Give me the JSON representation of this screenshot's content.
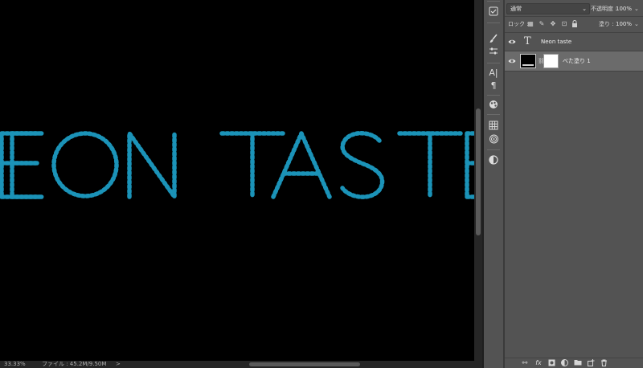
{
  "canvas": {
    "text": "EON TASTE",
    "background": "#000000",
    "glow_color": "#1b93b8"
  },
  "status_bar": {
    "zoom": "33.33%",
    "file_info": "ファイル : 45.2M/9.50M",
    "menu_arrow": ">"
  },
  "tools": [
    {
      "name": "brush-settings-icon"
    },
    {
      "name": "adjust-sliders-icon"
    },
    {
      "name": "character-icon",
      "glyph": "A|"
    },
    {
      "name": "paragraph-icon",
      "glyph": "¶"
    },
    {
      "name": "styles-icon"
    },
    {
      "name": "swatches-grid-icon"
    },
    {
      "name": "libraries-icon"
    },
    {
      "name": "adjustments-icon"
    }
  ],
  "layers_panel": {
    "blend_mode": "通常",
    "opacity_label": "不透明度 :",
    "opacity_value": "100%",
    "lock_label": "ロック :",
    "fill_label": "塗り :",
    "fill_value": "100%",
    "layers": [
      {
        "name": "Neon  taste",
        "type": "text",
        "visible": true,
        "selected": false
      },
      {
        "name": "べた塗り 1",
        "type": "fill",
        "visible": true,
        "selected": true
      }
    ],
    "bottom_icons": [
      "link-icon",
      "fx-icon",
      "mask-icon",
      "adjustment-layer-icon",
      "folder-icon",
      "new-layer-icon",
      "trash-icon"
    ],
    "fx_glyph": "fx"
  },
  "colors": {
    "panel_bg": "#535353",
    "selected_row": "#6b6b6b",
    "text_neon": "#1b93b8"
  }
}
